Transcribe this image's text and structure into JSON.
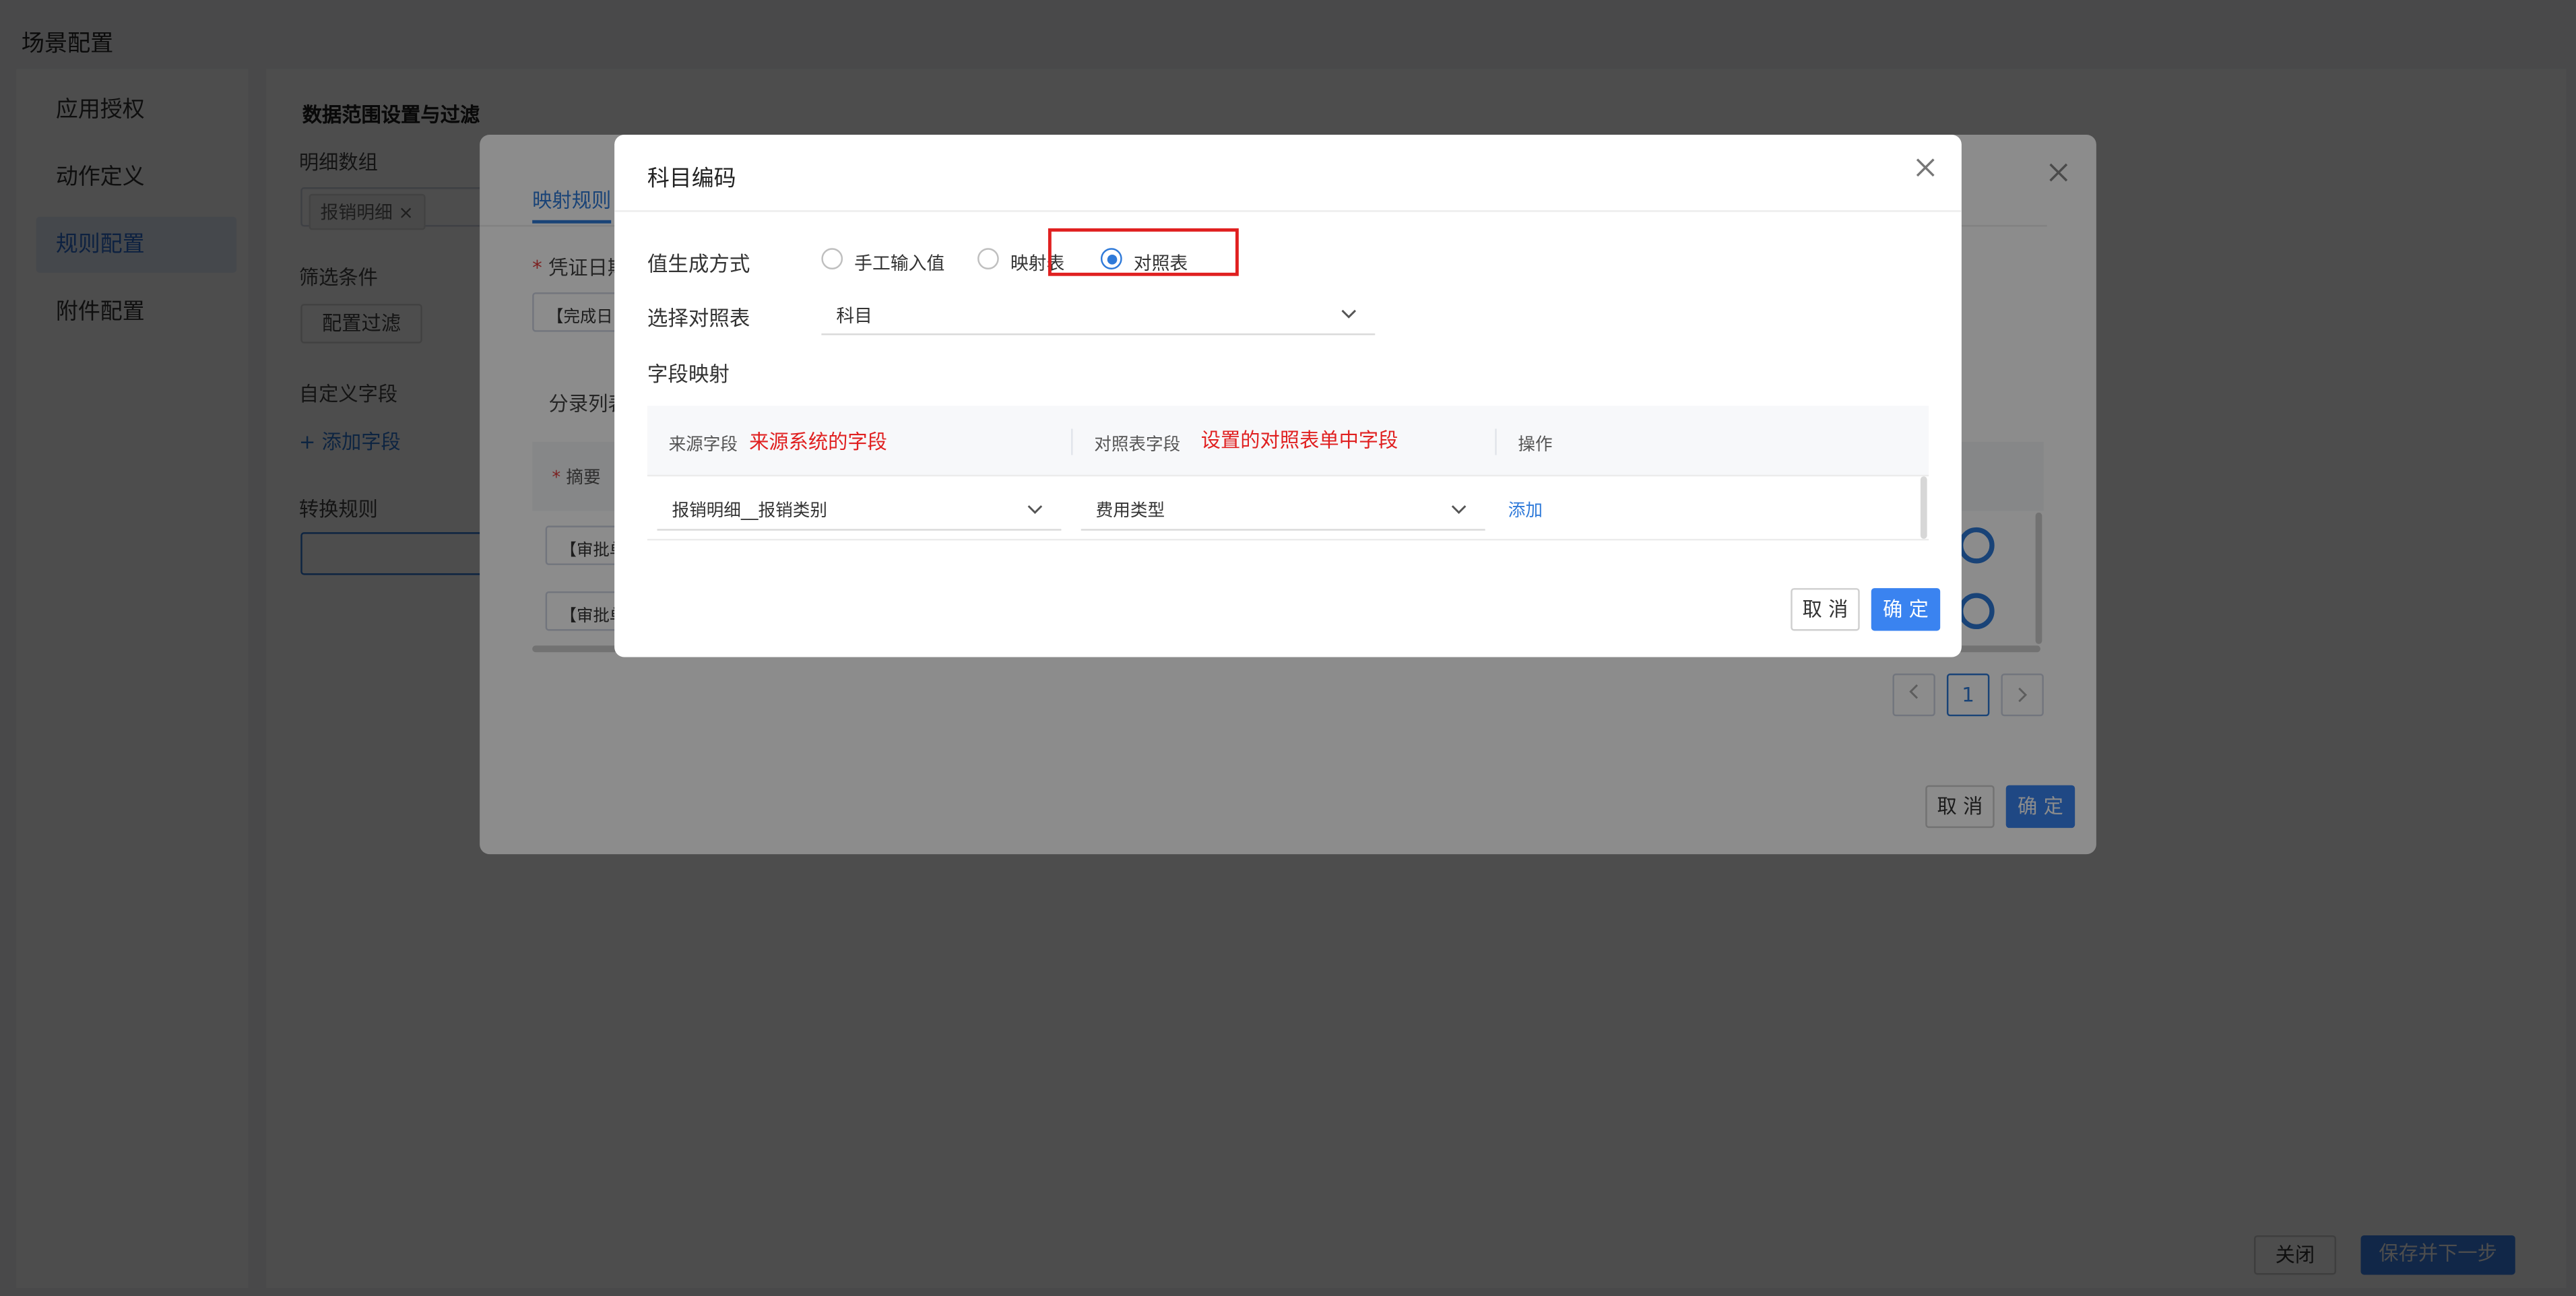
{
  "page": {
    "title": "场景配置",
    "sidebar": {
      "items": [
        {
          "label": "应用授权"
        },
        {
          "label": "动作定义"
        },
        {
          "label": "规则配置"
        },
        {
          "label": "附件配置"
        }
      ]
    },
    "section_title": "数据范围设置与过滤",
    "detail_group_label": "明细数组",
    "detail_group_tag": "报销明细",
    "filter_label": "筛选条件",
    "filter_button": "配置过滤",
    "custom_field_label": "自定义字段",
    "add_field_link": "+ 添加字段",
    "convert_rule_label": "转换规则",
    "footer": {
      "close_label": "关闭",
      "save_next_label": "保存并下一步"
    }
  },
  "mapping_dialog": {
    "tab_active": "映射规则",
    "voucher_date_label": "凭证日期",
    "voucher_date_value": "【完成日",
    "entry_list_label": "分录列表",
    "summary_col": "摘要",
    "row_values": [
      "【审批单",
      "【审批单"
    ],
    "pagination_current": "1",
    "cancel_label": "取 消",
    "ok_label": "确 定"
  },
  "subject_dialog": {
    "title": "科目编码",
    "value_mode_label": "值生成方式",
    "radio_options": [
      {
        "label": "手工输入值",
        "checked": false
      },
      {
        "label": "映射表",
        "checked": false
      },
      {
        "label": "对照表",
        "checked": true
      }
    ],
    "select_table_label": "选择对照表",
    "select_table_value": "科目",
    "field_mapping_label": "字段映射",
    "table": {
      "col_source": "来源字段",
      "col_source_note": "来源系统的字段",
      "col_target": "对照表字段",
      "col_target_note": "设置的对照表单中字段",
      "col_action": "操作",
      "rows": [
        {
          "source": "报销明细__报销类别",
          "target": "费用类型",
          "action": "添加"
        }
      ]
    },
    "cancel_label": "取 消",
    "ok_label": "确 定"
  },
  "colors": {
    "primary": "#3a83f0",
    "highlight_border": "#e02020",
    "annotation_text": "#e02020"
  }
}
